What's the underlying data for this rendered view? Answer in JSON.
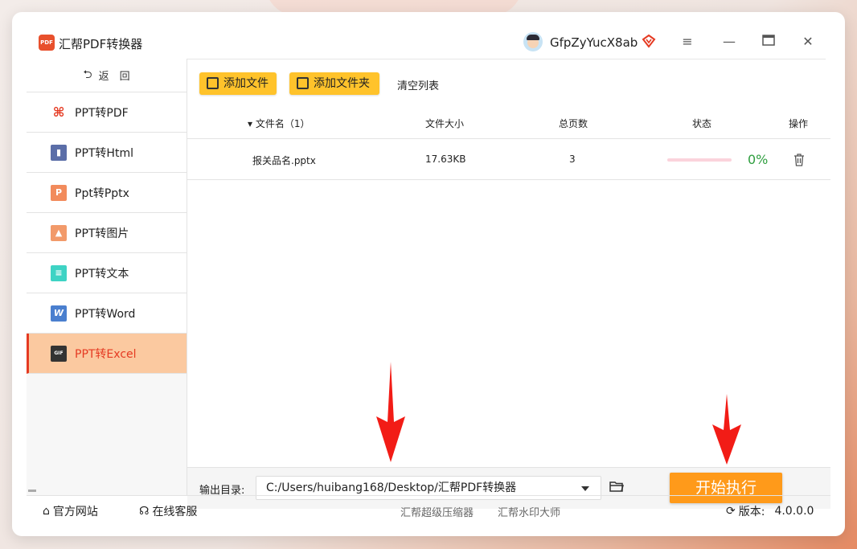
{
  "app": {
    "title": "汇帮PDF转换器",
    "logo_text": "PDF",
    "username": "GfpZyYucX8ab"
  },
  "sidebar": {
    "back_label": "返　回",
    "items": [
      {
        "label": "PPT转PDF",
        "icon": "pdf-icon",
        "active": false
      },
      {
        "label": "PPT转Html",
        "icon": "html-icon",
        "active": false
      },
      {
        "label": "Ppt转Pptx",
        "icon": "pptx-icon",
        "active": false
      },
      {
        "label": "PPT转图片",
        "icon": "image-icon",
        "active": false
      },
      {
        "label": "PPT转文本",
        "icon": "text-icon",
        "active": false
      },
      {
        "label": "PPT转Word",
        "icon": "word-icon",
        "active": false
      },
      {
        "label": "PPT转Excel",
        "icon": "excel-icon",
        "active": true
      }
    ]
  },
  "toolbar": {
    "add_file": "添加文件",
    "add_folder": "添加文件夹",
    "clear_list": "清空列表"
  },
  "table": {
    "headers": {
      "name": "文件名（1）",
      "size": "文件大小",
      "pages": "总页数",
      "status": "状态",
      "ops": "操作"
    },
    "rows": [
      {
        "name": "报关品名.pptx",
        "size": "17.63KB",
        "pages": "3",
        "progress": 0,
        "percent": "0%"
      }
    ]
  },
  "output": {
    "label": "输出目录:",
    "path": "C:/Users/huibang168/Desktop/汇帮PDF转换器"
  },
  "start_button": "开始执行",
  "footer": {
    "website": "官方网站",
    "service": "在线客服",
    "compressor": "汇帮超级压缩器",
    "watermark": "汇帮水印大师",
    "version_label": "版本:",
    "version_value": "4.0.0.0"
  },
  "colors": {
    "accent": "#ffc32b",
    "start": "#ff9a1a",
    "active_bg": "#fbc9a0",
    "active_text": "#e53a22",
    "percent": "#2e9e3f"
  }
}
